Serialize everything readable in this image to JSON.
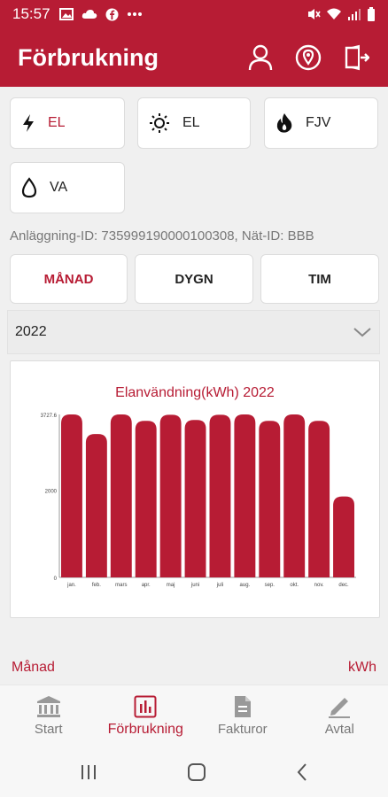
{
  "status": {
    "time": "15:57"
  },
  "header": {
    "title": "Förbrukning"
  },
  "types": [
    {
      "label": "EL",
      "icon": "bolt-icon"
    },
    {
      "label": "EL",
      "icon": "sun-icon"
    },
    {
      "label": "FJV",
      "icon": "flame-icon"
    },
    {
      "label": "VA",
      "icon": "drop-icon"
    }
  ],
  "meter": {
    "text": "Anläggning-ID: 735999190000100308, Nät-ID: BBB"
  },
  "period": {
    "month": "MÅNAD",
    "day": "DYGN",
    "hour": "TIM"
  },
  "year": {
    "value": "2022"
  },
  "chart_data": {
    "type": "bar",
    "title": "Elanvändning(kWh) 2022",
    "categories": [
      "jan.",
      "feb.",
      "mars",
      "apr.",
      "maj",
      "juni",
      "juli",
      "aug.",
      "sep.",
      "okt.",
      "nov.",
      "dec."
    ],
    "values": [
      3727.6,
      3280,
      3727,
      3580,
      3720,
      3600,
      3720,
      3727,
      3580,
      3727,
      3580,
      1850
    ],
    "yticks": [
      "3727.6",
      "2000",
      "0"
    ],
    "ylim": [
      0,
      3727.6
    ],
    "bar_color": "#b71c34"
  },
  "table": {
    "col_month": "Månad",
    "col_unit": "kWh"
  },
  "nav": {
    "start": "Start",
    "usage": "Förbrukning",
    "invoices": "Fakturor",
    "contract": "Avtal"
  },
  "colors": {
    "brand": "#b71c34"
  }
}
